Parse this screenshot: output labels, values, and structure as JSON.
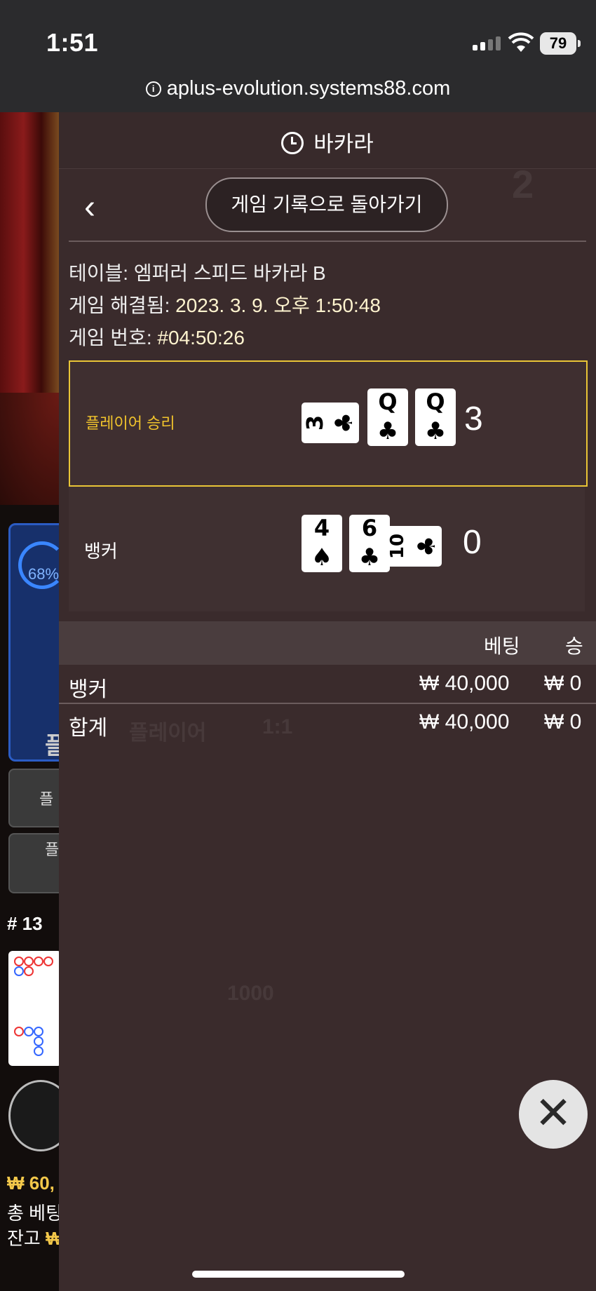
{
  "status": {
    "time": "1:51",
    "battery": "79",
    "url": "aplus-evolution.systems88.com"
  },
  "panel": {
    "title": "바카라",
    "back_button": "게임 기록으로 돌아가기",
    "table_label": "테이블: 엠퍼러 스피드 바카라 B",
    "resolved_label": "게임 해결됨: ",
    "resolved_value": "2023. 3. 9. 오후 1:50:48",
    "game_no_label": "게임 번호: ",
    "game_no_value": "#04:50:26"
  },
  "player": {
    "label": "플레이어 승리",
    "score": "3",
    "cards": [
      {
        "rank": "3",
        "suit": "♣",
        "orientation": "horizontal"
      },
      {
        "rank": "Q",
        "suit": "♣",
        "orientation": "vertical"
      },
      {
        "rank": "Q",
        "suit": "♣",
        "orientation": "vertical"
      }
    ]
  },
  "banker": {
    "label": "뱅커",
    "score": "0",
    "cards": [
      {
        "rank": "4",
        "suit": "♠",
        "orientation": "vertical"
      },
      {
        "rank": "6",
        "suit": "♣",
        "orientation": "vertical"
      },
      {
        "rank": "10",
        "suit": "♣",
        "orientation": "horizontal"
      }
    ]
  },
  "bets": {
    "headers": {
      "bet": "베팅",
      "win": "승"
    },
    "rows": [
      {
        "name": "뱅커",
        "bet": "₩ 40,000",
        "win": "₩ 0"
      },
      {
        "name": "합계",
        "bet": "₩ 40,000",
        "win": "₩ 0"
      }
    ]
  },
  "background": {
    "percent": "68%",
    "round": "# 13",
    "balance_main": "₩ 60,",
    "total_bet": "총 베팅",
    "remaining": "잔고 ",
    "remaining_value": "₩"
  },
  "colors": {
    "highlight": "#e9c536",
    "panel": "#3a2b2c",
    "accent_blue": "#2b5cc4"
  }
}
